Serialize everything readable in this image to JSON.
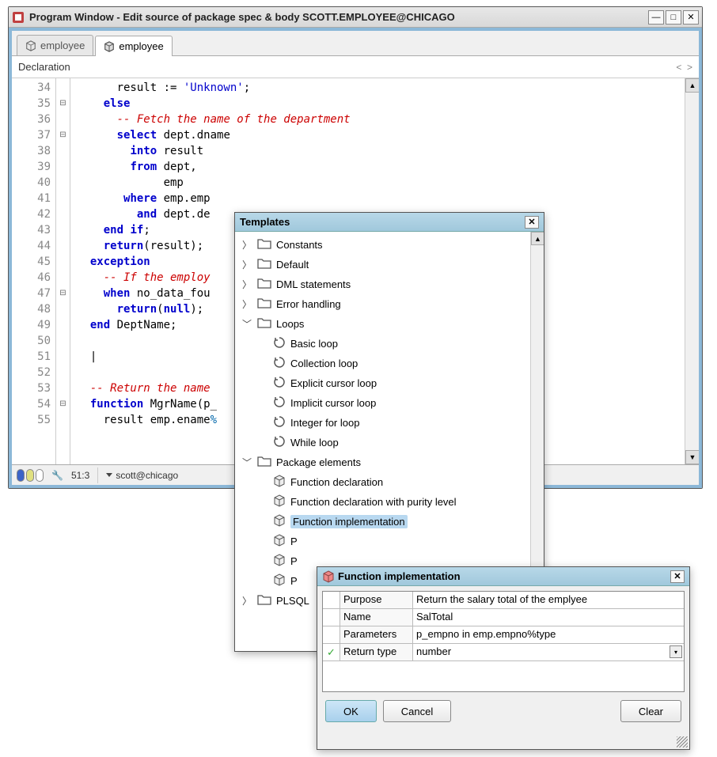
{
  "window": {
    "title": "Program Window - Edit source of package spec & body SCOTT.EMPLOYEE@CHICAGO"
  },
  "tabs": [
    {
      "label": "employee",
      "active": false
    },
    {
      "label": "employee",
      "active": true
    }
  ],
  "declaration_label": "Declaration",
  "code_lines": [
    {
      "n": 34,
      "fold": "",
      "html": "      result := <span class='s'>'Unknown'</span>;"
    },
    {
      "n": 35,
      "fold": "⊟",
      "html": "    <span class='k'>else</span>"
    },
    {
      "n": 36,
      "fold": "",
      "html": "      <span class='c'>-- Fetch the name of the department</span>"
    },
    {
      "n": 37,
      "fold": "⊟",
      "html": "      <span class='k'>select</span> dept.dname"
    },
    {
      "n": 38,
      "fold": "",
      "html": "        <span class='k'>into</span> result"
    },
    {
      "n": 39,
      "fold": "",
      "html": "        <span class='k'>from</span> dept,"
    },
    {
      "n": 40,
      "fold": "",
      "html": "             emp"
    },
    {
      "n": 41,
      "fold": "",
      "html": "       <span class='k'>where</span> emp.emp"
    },
    {
      "n": 42,
      "fold": "",
      "html": "         <span class='k'>and</span> dept.de"
    },
    {
      "n": 43,
      "fold": "",
      "html": "    <span class='k'>end</span> <span class='k'>if</span>;"
    },
    {
      "n": 44,
      "fold": "",
      "html": "    <span class='k'>return</span>(result);"
    },
    {
      "n": 45,
      "fold": "",
      "html": "  <span class='k'>exception</span>"
    },
    {
      "n": 46,
      "fold": "",
      "html": "    <span class='c'>-- If the employ</span>"
    },
    {
      "n": 47,
      "fold": "⊟",
      "html": "    <span class='k'>when</span> no_data_fou"
    },
    {
      "n": 48,
      "fold": "",
      "html": "      <span class='k'>return</span>(<span class='k'>null</span>);"
    },
    {
      "n": 49,
      "fold": "",
      "html": "  <span class='k'>end</span> DeptName;"
    },
    {
      "n": 50,
      "fold": "",
      "html": "  "
    },
    {
      "n": 51,
      "fold": "",
      "html": "  |"
    },
    {
      "n": 52,
      "fold": "",
      "html": "  "
    },
    {
      "n": 53,
      "fold": "",
      "html": "  <span class='c'>-- Return the name</span>"
    },
    {
      "n": 54,
      "fold": "⊟",
      "html": "  <span class='k'>function</span> MgrName(p_                                    <span class='typ'>%type</span> <span class='k'>is</span>"
    },
    {
      "n": 55,
      "fold": "",
      "html": "    result emp.ename<span class='typ'>%</span>"
    }
  ],
  "status": {
    "cursor": "51:3",
    "connection": "scott@chicago"
  },
  "templates": {
    "title": "Templates",
    "items": [
      {
        "lvl": 1,
        "exp": ">",
        "icon": "folder",
        "label": "Constants"
      },
      {
        "lvl": 1,
        "exp": ">",
        "icon": "folder",
        "label": "Default"
      },
      {
        "lvl": 1,
        "exp": ">",
        "icon": "folder",
        "label": "DML statements"
      },
      {
        "lvl": 1,
        "exp": ">",
        "icon": "folder",
        "label": "Error handling"
      },
      {
        "lvl": 1,
        "exp": "v",
        "icon": "folder",
        "label": "Loops"
      },
      {
        "lvl": 2,
        "exp": "",
        "icon": "loop",
        "label": "Basic loop"
      },
      {
        "lvl": 2,
        "exp": "",
        "icon": "loop",
        "label": "Collection loop"
      },
      {
        "lvl": 2,
        "exp": "",
        "icon": "loop",
        "label": "Explicit cursor loop"
      },
      {
        "lvl": 2,
        "exp": "",
        "icon": "loop",
        "label": "Implicit cursor loop"
      },
      {
        "lvl": 2,
        "exp": "",
        "icon": "loop",
        "label": "Integer for loop"
      },
      {
        "lvl": 2,
        "exp": "",
        "icon": "loop",
        "label": "While loop"
      },
      {
        "lvl": 1,
        "exp": "v",
        "icon": "folder",
        "label": "Package elements"
      },
      {
        "lvl": 2,
        "exp": "",
        "icon": "cube",
        "label": "Function declaration"
      },
      {
        "lvl": 2,
        "exp": "",
        "icon": "cube",
        "label": "Function declaration with purity level"
      },
      {
        "lvl": 2,
        "exp": "",
        "icon": "cube",
        "label": "Function implementation",
        "selected": true
      },
      {
        "lvl": 2,
        "exp": "",
        "icon": "cube",
        "label": "P"
      },
      {
        "lvl": 2,
        "exp": "",
        "icon": "cube",
        "label": "P"
      },
      {
        "lvl": 2,
        "exp": "",
        "icon": "cube",
        "label": "P"
      },
      {
        "lvl": 1,
        "exp": ">",
        "icon": "folder",
        "label": "PLSQL"
      }
    ]
  },
  "dialog": {
    "title": "Function implementation",
    "fields": [
      {
        "check": false,
        "label": "Purpose",
        "value": "Return the salary total of the emplyee",
        "dd": false
      },
      {
        "check": false,
        "label": "Name",
        "value": "SalTotal",
        "dd": false
      },
      {
        "check": false,
        "label": "Parameters",
        "value": "p_empno in emp.empno%type",
        "dd": false
      },
      {
        "check": true,
        "label": "Return type",
        "value": "number",
        "dd": true
      }
    ],
    "buttons": {
      "ok": "OK",
      "cancel": "Cancel",
      "clear": "Clear"
    }
  }
}
